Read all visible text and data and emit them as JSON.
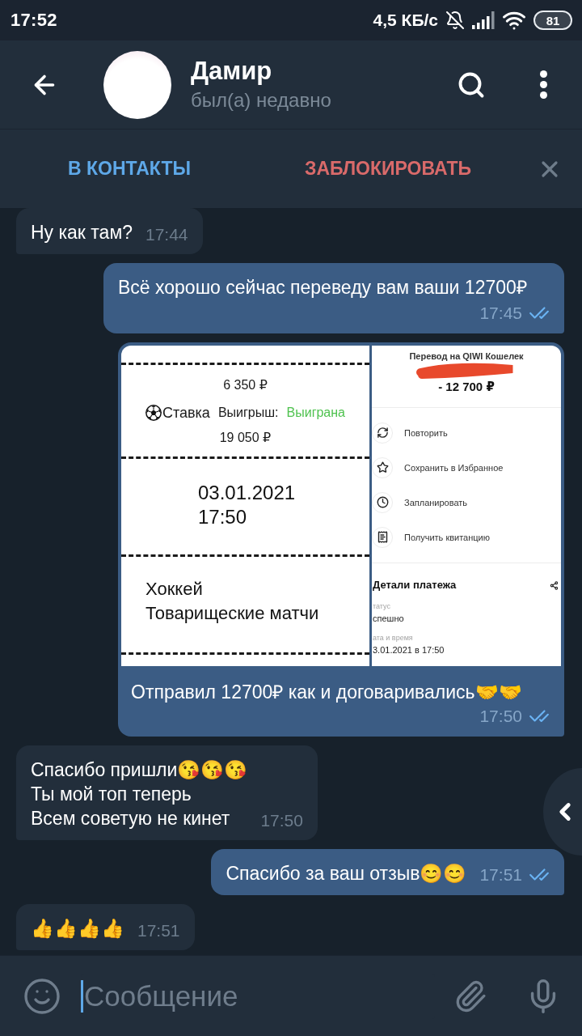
{
  "status_bar": {
    "time": "17:52",
    "network_speed": "4,5 КБ/с",
    "battery": "81"
  },
  "header": {
    "name": "Дамир",
    "status": "был(а) недавно"
  },
  "contact_bar": {
    "add_contact": "В КОНТАКТЫ",
    "block": "ЗАБЛОКИРОВАТЬ"
  },
  "messages": [
    {
      "kind": "text",
      "outgoing": false,
      "text": "Ну как там?",
      "time": "17:44"
    },
    {
      "kind": "text",
      "outgoing": true,
      "text": "Всё хорошо сейчас переведу вам ваши 12700₽",
      "time": "17:45",
      "read": true
    },
    {
      "kind": "photo",
      "outgoing": true,
      "photos": [
        {
          "kind": "bet_slip",
          "stake": "6 350 ₽",
          "stake_label": "Ставка",
          "payout_label": "Выигрыш:",
          "result": "Выиграна",
          "payout": "19 050 ₽",
          "date": "03.01.2021",
          "time": "17:50",
          "sport": "Хоккей",
          "league": "Товарищеские матчи"
        },
        {
          "kind": "payment_screen",
          "title": "Перевод на QIWI Кошелек",
          "amount": "- 12 700 ₽",
          "actions": [
            "Повторить",
            "Сохранить в Избранное",
            "Запланировать",
            "Получить квитанцию"
          ],
          "details_title": "Детали платежа",
          "details": [
            {
              "label": "татус",
              "value": "спешно"
            },
            {
              "label": "ата и время",
              "value": "3.01.2021 в 17:50"
            }
          ]
        }
      ],
      "caption": "Отправил 12700₽ как и договаривались🤝🤝",
      "time": "17:50",
      "read": true
    },
    {
      "kind": "text",
      "outgoing": false,
      "text": "Спасибо пришли😘😘😘\nТы мой топ теперь\nВсем советую не кинет",
      "time": "17:50"
    },
    {
      "kind": "text",
      "outgoing": true,
      "text": "Спасибо за ваш отзыв😊😊",
      "time": "17:51",
      "read": true
    },
    {
      "kind": "text",
      "outgoing": false,
      "text": "👍👍👍👍",
      "time": "17:51"
    }
  ],
  "composer": {
    "placeholder": "Сообщение"
  }
}
